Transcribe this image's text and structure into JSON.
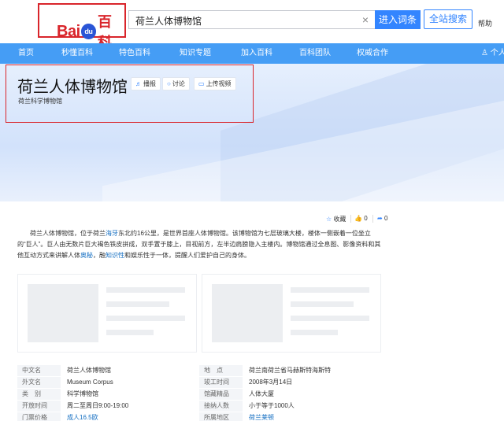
{
  "header": {
    "logo_bai": "Bai",
    "logo_du": "du",
    "logo_baike": "百科",
    "search_value": "荷兰人体博物馆",
    "clear_icon": "×",
    "enter_button": "进入词条",
    "all_search_button": "全站搜索",
    "help_link": "帮助"
  },
  "nav": {
    "items": [
      "首页",
      "秒懂百科",
      "特色百科",
      "知识专题",
      "加入百科",
      "百科团队",
      "权威合作"
    ],
    "user_label": "个人"
  },
  "hero": {
    "title": "荷兰人体博物馆",
    "subtitle": "荷兰科学博物馆",
    "play_label": "播报",
    "discuss_label": "讨论",
    "upload_label": "上传视频"
  },
  "actions": {
    "collect_label": "收藏",
    "like_count": "0",
    "share_count": "0"
  },
  "summary": {
    "p1": "荷兰人体博物馆，位于荷兰",
    "link_hague": "海牙",
    "p2": "东北约16公里，是世界首座人体博物馆。该博物馆为七层玻璃大楼，楼体一侧嵌着一位坐立的“巨人”。巨人由无数片巨大褐色铁皮拼成，双手置于膝上，目视前方，左半边肩膀隐入主楼内。博物馆通过全息图、影像资料和其他互动方式来讲解人体",
    "link_mystery": "奥秘",
    "p3": "，融",
    "link_knowledge": "知识性",
    "p4": "和娱乐性于一体，提醒人们爱护自己的身体。"
  },
  "infobox": {
    "rows": [
      {
        "k1": "中文名",
        "v1": "荷兰人体博物馆",
        "k2": "地　点",
        "v2": "荷兰南荷兰省马赫斯特海斯特"
      },
      {
        "k1": "外文名",
        "v1": "Museum Corpus",
        "k2": "竣工时间",
        "v2": "2008年3月14日"
      },
      {
        "k1": "类　别",
        "v1": "科学博物馆",
        "k2": "馆藏精品",
        "v2": "人体大厦"
      },
      {
        "k1": "开放时间",
        "v1": "周二至周日9:00-19:00",
        "k2": "接纳人数",
        "v2": "小于等于1000人"
      },
      {
        "k1": "门票价格",
        "v1": "成人16.5欧",
        "k2": "所属地区",
        "v2": "荷兰莱顿"
      }
    ]
  },
  "colors": {
    "brand_red": "#d9252b",
    "brand_blue": "#3385ff",
    "nav_blue": "#459df5",
    "link_blue": "#136ec2"
  },
  "icons": [
    "clear-icon",
    "speaker-icon",
    "chat-icon",
    "video-icon",
    "star-icon",
    "thumb-up-icon",
    "share-icon",
    "user-icon"
  ]
}
